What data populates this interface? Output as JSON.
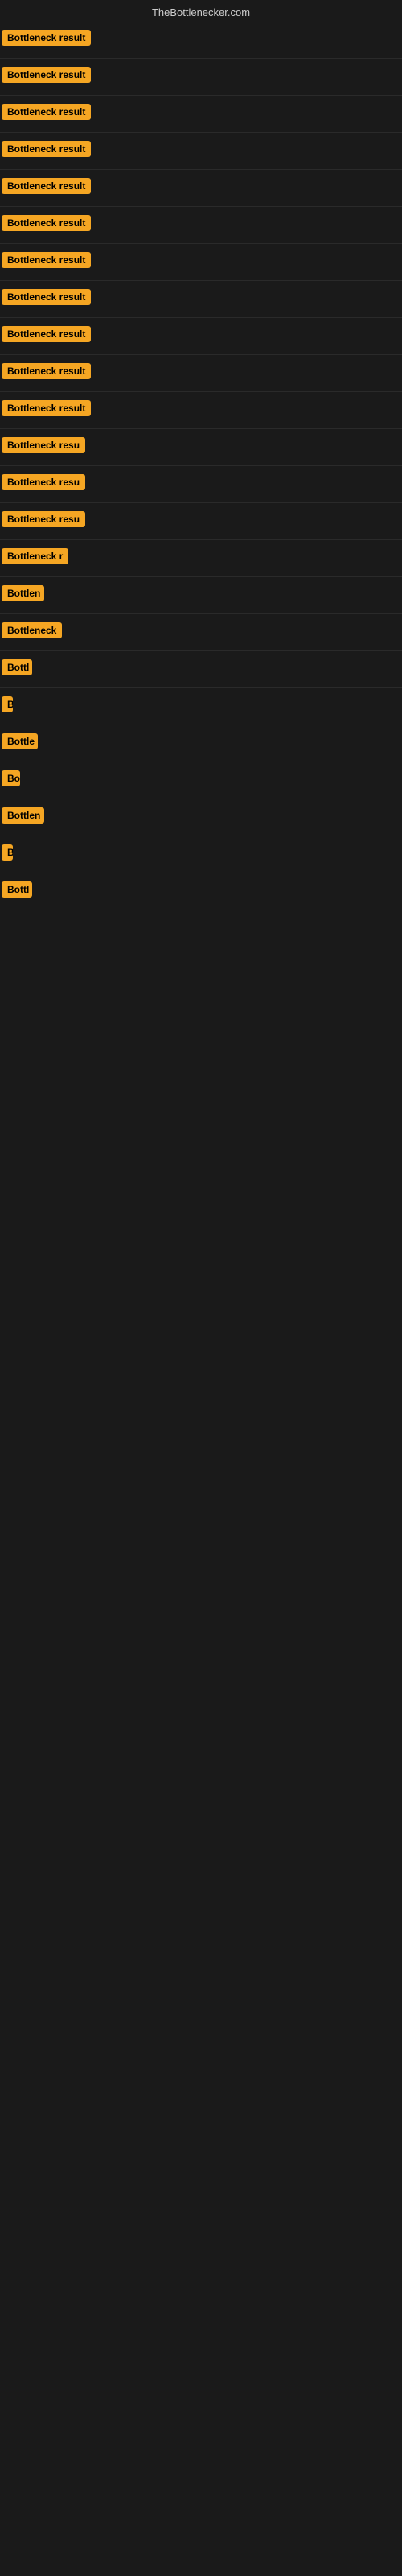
{
  "header": {
    "title": "TheBottlenecker.com"
  },
  "results": [
    {
      "label": "Bottleneck result",
      "truncated": false
    },
    {
      "label": "Bottleneck result",
      "truncated": false
    },
    {
      "label": "Bottleneck result",
      "truncated": false
    },
    {
      "label": "Bottleneck result",
      "truncated": false
    },
    {
      "label": "Bottleneck result",
      "truncated": false
    },
    {
      "label": "Bottleneck result",
      "truncated": false
    },
    {
      "label": "Bottleneck result",
      "truncated": false
    },
    {
      "label": "Bottleneck result",
      "truncated": false
    },
    {
      "label": "Bottleneck result",
      "truncated": false
    },
    {
      "label": "Bottleneck result",
      "truncated": false
    },
    {
      "label": "Bottleneck result",
      "truncated": false
    },
    {
      "label": "Bottleneck resu",
      "truncated": true
    },
    {
      "label": "Bottleneck resu",
      "truncated": true
    },
    {
      "label": "Bottleneck resu",
      "truncated": true
    },
    {
      "label": "Bottleneck r",
      "truncated": true
    },
    {
      "label": "Bottlen",
      "truncated": true
    },
    {
      "label": "Bottleneck",
      "truncated": true
    },
    {
      "label": "Bottl",
      "truncated": true
    },
    {
      "label": "B",
      "truncated": true
    },
    {
      "label": "Bottle",
      "truncated": true
    },
    {
      "label": "Bot",
      "truncated": true
    },
    {
      "label": "Bottlen",
      "truncated": true
    },
    {
      "label": "B",
      "truncated": true
    },
    {
      "label": "Bottl",
      "truncated": true
    }
  ],
  "colors": {
    "badge_bg": "#f5a623",
    "badge_text": "#000000",
    "header_text": "#cccccc",
    "body_bg": "#1a1a1a"
  }
}
